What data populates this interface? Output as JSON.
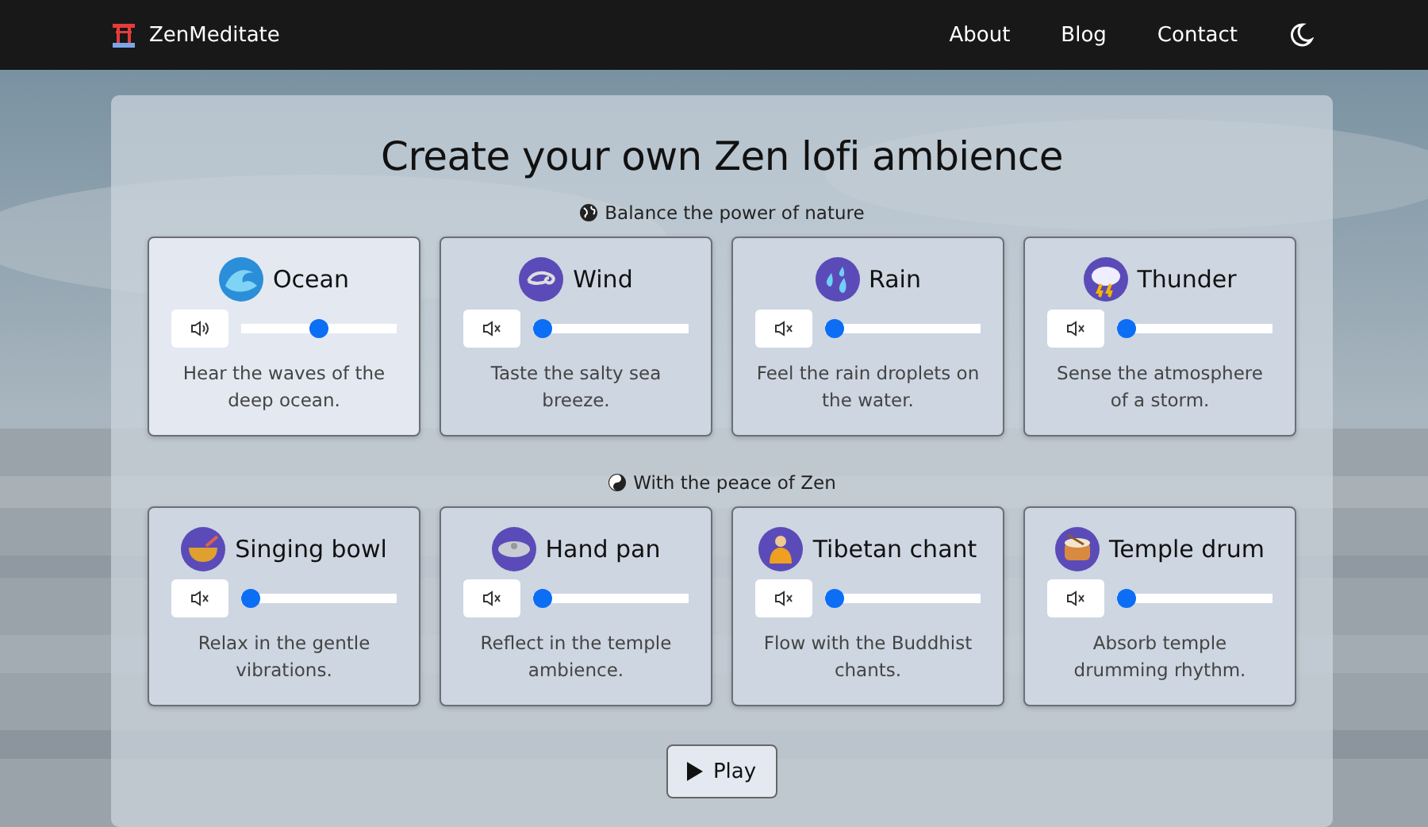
{
  "navbar": {
    "brand": "ZenMeditate",
    "links": [
      "About",
      "Blog",
      "Contact"
    ]
  },
  "title": "Create your own Zen lofi ambience",
  "sections": [
    {
      "heading": "Balance the power of nature",
      "cards": [
        {
          "name": "Ocean",
          "description": "Hear the waves of the deep ocean.",
          "active": true,
          "muted": false,
          "level": 0.5
        },
        {
          "name": "Wind",
          "description": "Taste the salty sea breeze.",
          "active": false,
          "muted": true,
          "level": 0
        },
        {
          "name": "Rain",
          "description": "Feel the rain droplets on the water.",
          "active": false,
          "muted": true,
          "level": 0
        },
        {
          "name": "Thunder",
          "description": "Sense the atmosphere of a storm.",
          "active": false,
          "muted": true,
          "level": 0
        }
      ]
    },
    {
      "heading": "With the peace of Zen",
      "cards": [
        {
          "name": "Singing bowl",
          "description": "Relax in the gentle vibrations.",
          "active": false,
          "muted": true,
          "level": 0
        },
        {
          "name": "Hand pan",
          "description": "Reflect in the temple ambience.",
          "active": false,
          "muted": true,
          "level": 0
        },
        {
          "name": "Tibetan chant",
          "description": "Flow with the Buddhist chants.",
          "active": false,
          "muted": true,
          "level": 0
        },
        {
          "name": "Temple drum",
          "description": "Absorb temple drumming rhythm.",
          "active": false,
          "muted": true,
          "level": 0
        }
      ]
    }
  ],
  "play_button": {
    "label": "Play"
  }
}
